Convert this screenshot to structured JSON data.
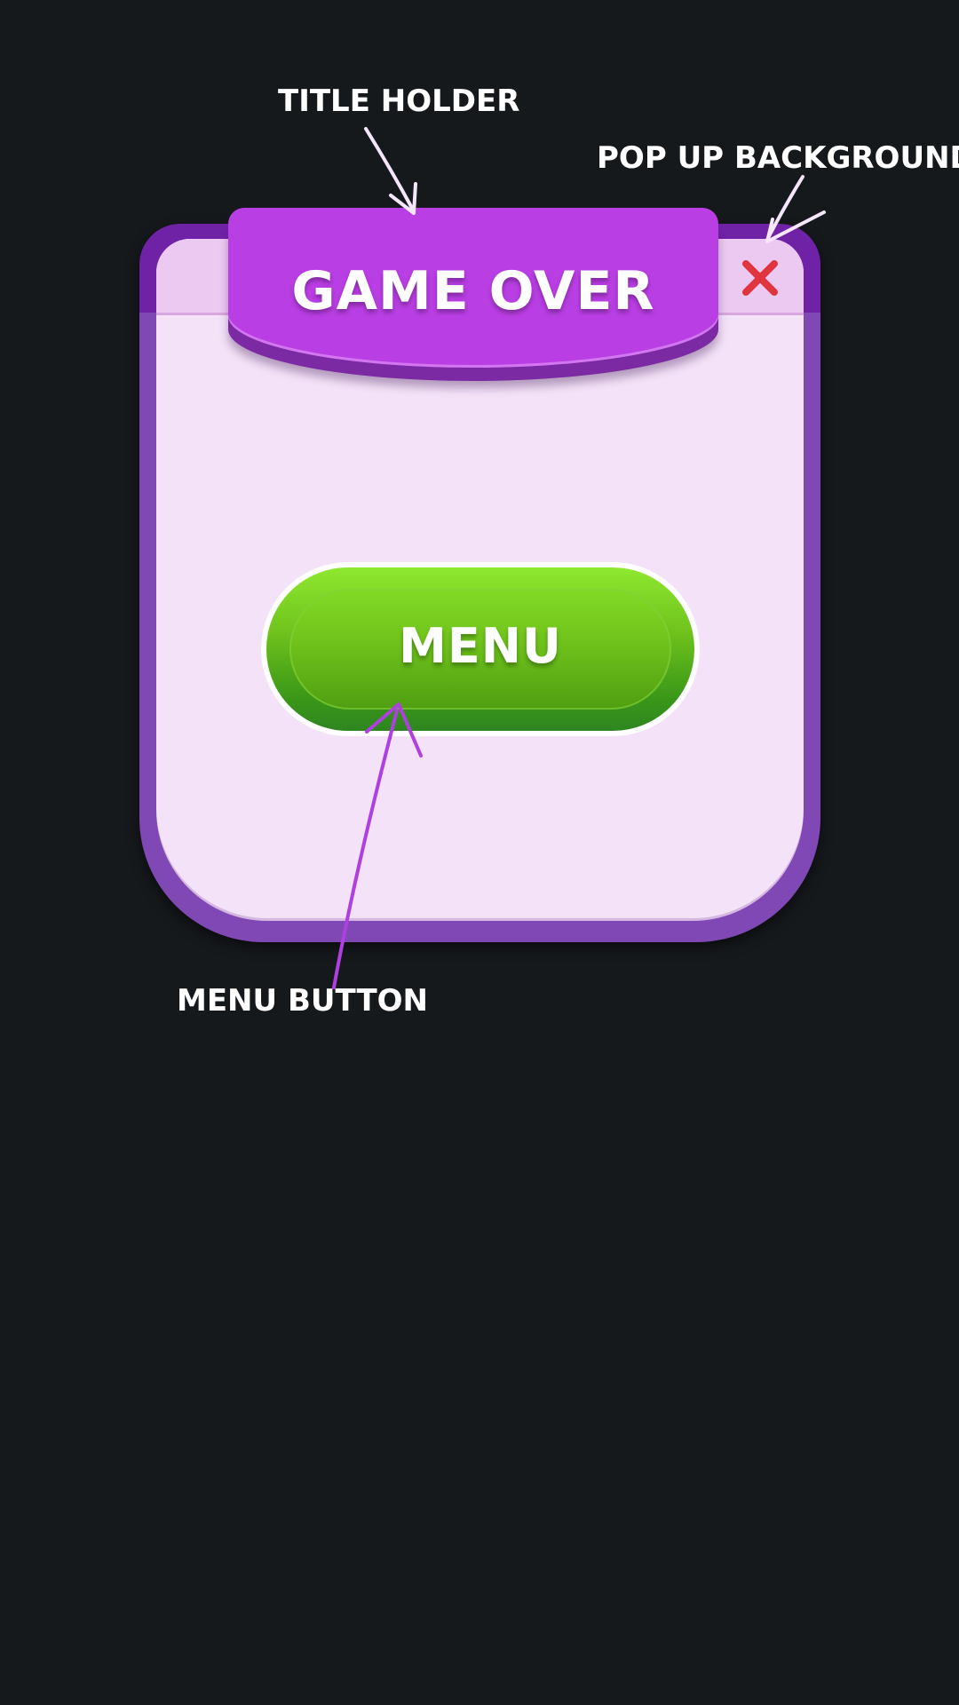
{
  "popup": {
    "title": "GAME OVER",
    "close_icon": "close-x-icon",
    "menu_button_label": "MENU"
  },
  "annotations": {
    "title_holder": "TITLE HOLDER",
    "popup_background": "POP UP BACKGROUND",
    "menu_button": "MENU BUTTON"
  },
  "colors": {
    "background": "#16191c",
    "popup_frame": "#7f48b4",
    "popup_panel": "#f4e2f8",
    "title_holder": "#b93ee3",
    "close_icon": "#e0353f",
    "menu_button_top": "#8fe830",
    "menu_button_bottom": "#2e8620",
    "annotation_arrow_light": "#f6e6fb",
    "annotation_arrow_purple": "#b03fe0"
  }
}
